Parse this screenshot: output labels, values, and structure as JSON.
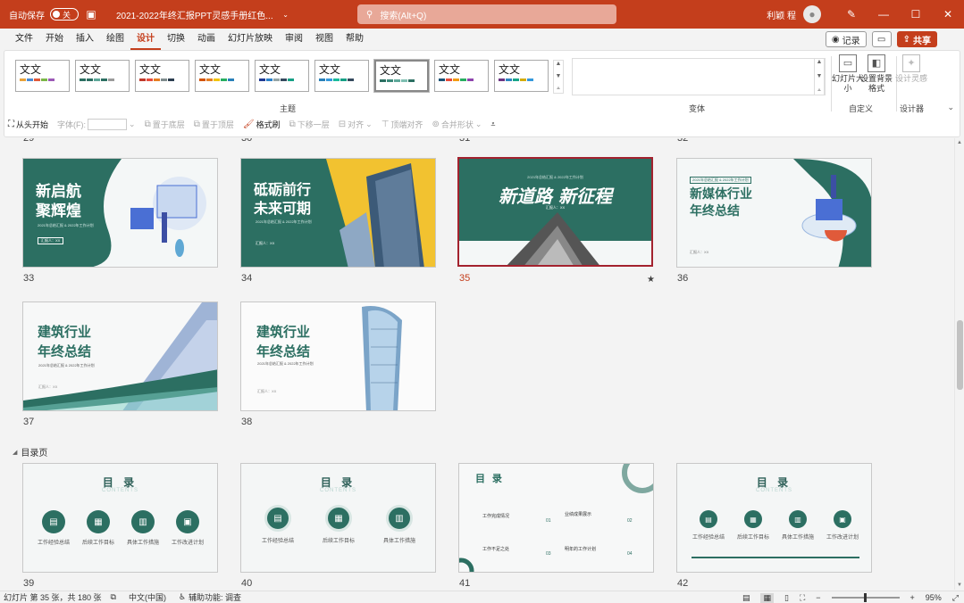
{
  "titlebar": {
    "autosave_label": "自动保存",
    "autosave_state": "关",
    "doc_title": "2021-2022年终汇报PPT灵感手册红色...",
    "search_placeholder": "搜索(Alt+Q)",
    "user_name": "利颖 程"
  },
  "menu": {
    "tabs": [
      "文件",
      "开始",
      "插入",
      "绘图",
      "设计",
      "切换",
      "动画",
      "幻灯片放映",
      "审阅",
      "视图",
      "帮助"
    ],
    "active_tab": "设计",
    "record_label": "记录",
    "share_label": "共享"
  },
  "ribbon": {
    "themes": [
      {
        "label": "文文",
        "colors": [
          "#e8a23a",
          "#4a8bd4",
          "#e05a3a",
          "#7ab648",
          "#9b59b6"
        ]
      },
      {
        "label": "文文",
        "colors": [
          "#2c6f62",
          "#2c6f62",
          "#5fa89a",
          "#2c6f62",
          "#9b9b9b"
        ]
      },
      {
        "label": "文文",
        "colors": [
          "#c0392b",
          "#e74c3c",
          "#e67e22",
          "#7f8c8d",
          "#2c3e50"
        ]
      },
      {
        "label": "文文",
        "colors": [
          "#d35400",
          "#e67e22",
          "#f1c40f",
          "#27ae60",
          "#2980b9"
        ]
      },
      {
        "label": "文文",
        "colors": [
          "#1f3a93",
          "#2c82c9",
          "#95a5a6",
          "#34495e",
          "#16a085"
        ]
      },
      {
        "label": "文文",
        "colors": [
          "#2980b9",
          "#3498db",
          "#1abc9c",
          "#16a085",
          "#34495e"
        ]
      },
      {
        "label": "文文",
        "colors": [
          "#2c6f62",
          "#3c8a7a",
          "#5fa89a",
          "#7fbfb2",
          "#2c6f62"
        ]
      },
      {
        "label": "文文",
        "colors": [
          "#1a5276",
          "#e74c3c",
          "#f39c12",
          "#27ae60",
          "#8e44ad"
        ]
      },
      {
        "label": "文文",
        "colors": [
          "#6c3483",
          "#2e86c1",
          "#17a589",
          "#d4ac0d",
          "#3498db"
        ]
      }
    ],
    "group_theme": "主题",
    "group_variant": "变体",
    "group_customize": "自定义",
    "group_designer": "设计器",
    "btn_slide_size": "幻灯片大小",
    "btn_format_bg": "设置背景格式",
    "btn_designer": "设计灵感",
    "qa": {
      "from_start": "从头开始",
      "font_label": "字体(F):",
      "bring_front": "置于底层",
      "send_back": "置于顶层",
      "format_painter": "格式刷",
      "move_down": "下移一层",
      "align": "对齐",
      "distribute": "顶端对齐",
      "merge": "合并形状"
    }
  },
  "sorter": {
    "top_row_numbers": [
      "29",
      "30",
      "31",
      "32"
    ],
    "section_title": "目录页",
    "slides": [
      {
        "num": "33",
        "title1": "新启航",
        "title2": "聚辉煌",
        "sub": "2021年总结汇报 & 2022年工作计划",
        "name": "汇报人：XX"
      },
      {
        "num": "34",
        "title1": "砥砺前行",
        "title2": "未来可期",
        "sub": "2021年总结汇报 & 2022年工作计划",
        "name": "汇报人：XX"
      },
      {
        "num": "35",
        "title1": "新道路 新征程",
        "sub": "2021年总结汇报 & 2022年工作计划",
        "name": "汇报人：XX"
      },
      {
        "num": "36",
        "title1": "新媒体行业",
        "title2": "年终总结",
        "sub": "2021年总结汇报 & 2022年工作计划",
        "name": "汇报人：XX"
      },
      {
        "num": "37",
        "title1": "建筑行业",
        "title2": "年终总结",
        "sub": "2021年总结汇报 & 2022年工作计划",
        "name": "汇报人：XX"
      },
      {
        "num": "38",
        "title1": "建筑行业",
        "title2": "年终总结",
        "sub": "2021年总结汇报 & 2022年工作计划",
        "name": "汇报人：XX"
      },
      {
        "num": "39",
        "toc_title": "目 录",
        "toc_sub": "CONTENTS",
        "items": [
          "工作经验总结",
          "后续工作目标",
          "具体工作措施",
          "工作改进计划"
        ]
      },
      {
        "num": "40",
        "toc_title": "目 录",
        "toc_sub": "CONTENTS",
        "items": [
          "工作经验总结",
          "后续工作目标",
          "具体工作措施"
        ]
      },
      {
        "num": "41",
        "toc_title": "目 录",
        "toc_sub": "CONTENTS",
        "items": [
          "工作完成情况",
          "业绩成果展示",
          "工作不足之处",
          "明年的工作计划"
        ],
        "item_nums": [
          "01",
          "02",
          "03",
          "04"
        ]
      },
      {
        "num": "42",
        "toc_title": "目 录",
        "toc_sub": "CONTENTS",
        "items": [
          "工作经验总结",
          "后续工作目标",
          "具体工作措施",
          "工作改进计划"
        ]
      }
    ],
    "selected_slide": "35",
    "star": "★"
  },
  "status": {
    "slide_info": "幻灯片 第 35 张，共 180 张",
    "language": "中文(中国)",
    "accessibility": "辅助功能: 调查",
    "zoom": "95%"
  }
}
